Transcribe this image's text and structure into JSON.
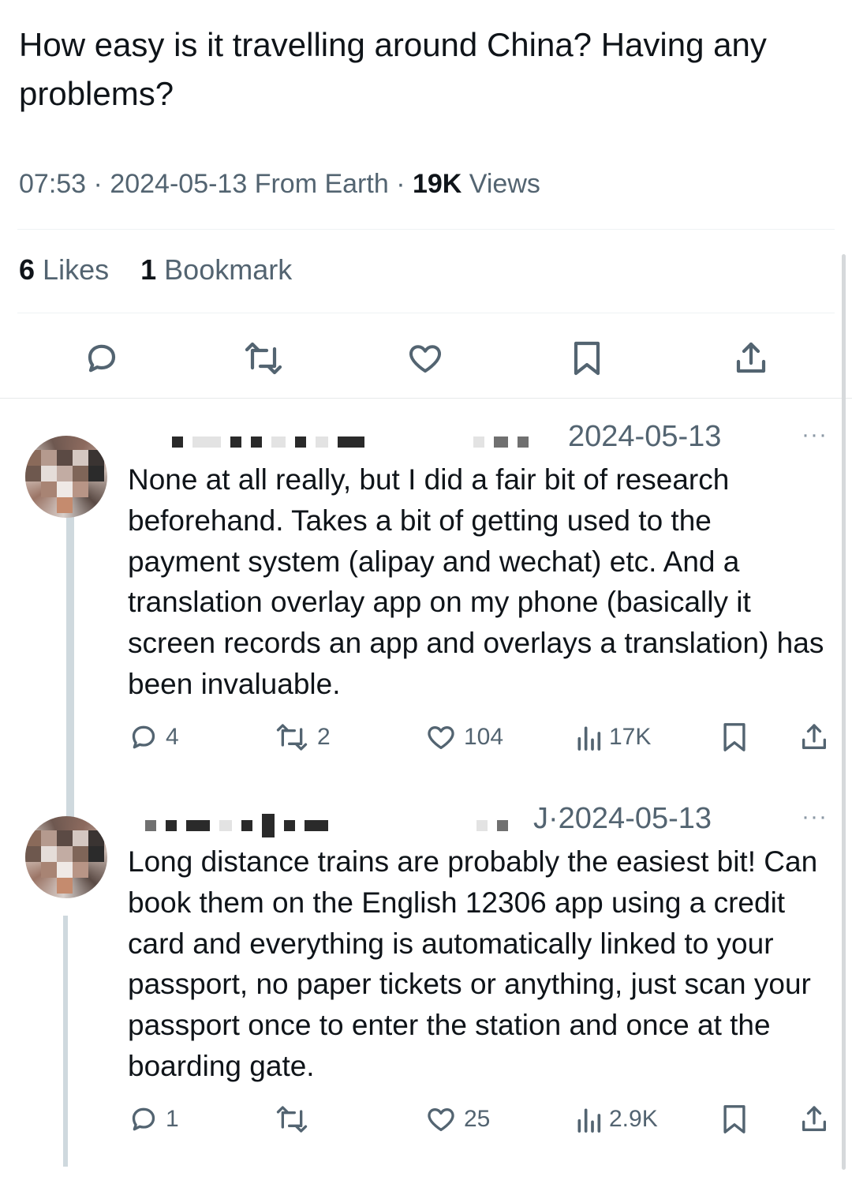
{
  "post": {
    "text": "How easy is it travelling around China? Having any problems?",
    "time": "07:53",
    "sep1": "·",
    "date_location": "2024-05-13 From Earth",
    "sep2": "·",
    "views_count": "19K",
    "views_label": "Views",
    "likes_count": "6",
    "likes_label": "Likes",
    "bookmarks_count": "1",
    "bookmarks_label": "Bookmark"
  },
  "icons": {
    "reply": "comment-bubble-icon",
    "repost": "repost-arrows-icon",
    "like": "heart-icon",
    "bookmark": "bookmark-icon",
    "share": "share-upload-icon",
    "views": "views-bar-chart-icon",
    "more": "more-dots-icon"
  },
  "colors": {
    "text": "#0f1419",
    "secondary": "#536471",
    "divider": "#eff3f4",
    "thread_line": "#cfd9de"
  },
  "replies": [
    {
      "date": "2024-05-13",
      "more": "···",
      "text": "None at all really, but I did a fair bit of research beforehand. Takes a bit of getting used to the payment system (alipay and wechat) etc. And a translation overlay app on my phone (basically it screen records an app and overlays a translation) has been invaluable.",
      "reply_count": "4",
      "repost_count": "2",
      "like_count": "104",
      "views_count": "17K"
    },
    {
      "date": "J·2024-05-13",
      "more": "···",
      "text": "Long distance trains are probably the easiest bit! Can book them on the English 12306 app using a credit card and everything is automatically linked to your passport, no paper tickets or anything, just scan your passport once to enter the station and once at the boarding gate.",
      "reply_count": "1",
      "repost_count": "",
      "like_count": "25",
      "views_count": "2.9K"
    }
  ]
}
